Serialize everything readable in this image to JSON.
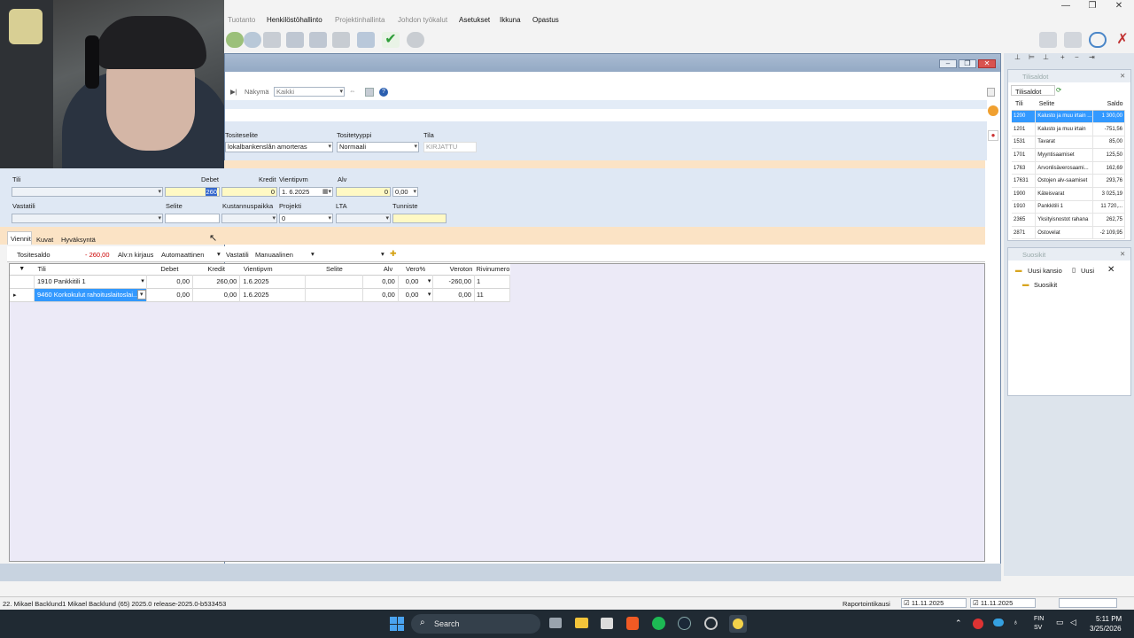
{
  "window": {
    "btn_min": "—",
    "btn_max": "❐",
    "btn_close": "✕"
  },
  "menu": {
    "items": [
      {
        "label": "Tuotanto",
        "enabled": false
      },
      {
        "label": "Henkilöstöhallinto",
        "enabled": true
      },
      {
        "label": "Projektinhallinta",
        "enabled": false
      },
      {
        "label": "Johdon työkalut",
        "enabled": false
      },
      {
        "label": "Asetukset",
        "enabled": true
      },
      {
        "label": "Ikkuna",
        "enabled": true
      },
      {
        "label": "Opastus",
        "enabled": true
      }
    ]
  },
  "nav": {
    "nakyma_label": "Näkymä",
    "nakyma_value": "Kaikki"
  },
  "header_fields": {
    "tositeselite_label": "Tositeselite",
    "tositeselite_value": "lokalbankenslån amorteras",
    "tositetyyppi_label": "Tositetyyppi",
    "tositetyyppi_value": "Normaali",
    "tila_label": "Tila",
    "tila_value": "KIRJATTU"
  },
  "entry": {
    "tili_label": "Tili",
    "debet_label": "Debet",
    "debet_value": "260",
    "kredit_label": "Kredit",
    "kredit_value": "0",
    "vientipvm_label": "Vientipvm",
    "vientipvm_value": "1.  6.2025",
    "alv_label": "Alv",
    "alv_value": "0",
    "alv_pct": "0,00",
    "vastatili_label": "Vastatili",
    "selite_label": "Selite",
    "kustannuspaikka_label": "Kustannuspaikka",
    "projekti_label": "Projekti",
    "projekti_value": "0",
    "lta_label": "LTA",
    "tunniste_label": "Tunniste"
  },
  "tabs": [
    "Viennit",
    "Kuvat",
    "Hyväksyntä"
  ],
  "summary": {
    "tositesaldo_label": "Tositesaldo",
    "tositesaldo_value": "- 260,00",
    "alv_kirjaus_label": "Alv:n kirjaus",
    "alv_kirjaus_value": "Automaattinen",
    "vastatili_label": "Vastatili",
    "vastatili_value": "Manuaalinen"
  },
  "grid": {
    "columns": [
      "Tili",
      "Debet",
      "Kredit",
      "Vientipvm",
      "Selite",
      "Alv",
      "Vero%",
      "Veroton",
      "Rivinumero"
    ],
    "rows": [
      {
        "tili": "1910 Pankkitili 1",
        "debet": "0,00",
        "kredit": "260,00",
        "vientipvm": "1.6.2025",
        "selite": "",
        "alv": "0,00",
        "vero": "0,00",
        "veroton": "-260,00",
        "rivinumero": "1"
      },
      {
        "tili": "9460 Korkokulut rahoituslaitoslai...",
        "debet": "0,00",
        "kredit": "0,00",
        "vientipvm": "1.6.2025",
        "selite": "",
        "alv": "0,00",
        "vero": "0,00",
        "veroton": "0,00",
        "rivinumero": "11"
      }
    ]
  },
  "tilisaldot": {
    "title": "Tilisaldot",
    "tab": "Tilisaldot",
    "columns": [
      "Tili",
      "Selite",
      "Saldo"
    ],
    "rows": [
      {
        "tili": "1200",
        "selite": "Kalusto ja muu irtain ...",
        "saldo": "1 300,00",
        "selected": true
      },
      {
        "tili": "1201",
        "selite": "Kalusto ja muu irtain",
        "saldo": "-751,56"
      },
      {
        "tili": "1531",
        "selite": "Tavarat",
        "saldo": "85,00"
      },
      {
        "tili": "1701",
        "selite": "Myyntisaamiset",
        "saldo": "125,50"
      },
      {
        "tili": "1763",
        "selite": "Arvonlisäverosaami...",
        "saldo": "162,69"
      },
      {
        "tili": "17631",
        "selite": "Ostojen alv-saamiset",
        "saldo": "293,76"
      },
      {
        "tili": "1900",
        "selite": "Käteisvarat",
        "saldo": "3 025,19"
      },
      {
        "tili": "1910",
        "selite": "Pankkitili 1",
        "saldo": "11 720,..."
      },
      {
        "tili": "2365",
        "selite": "Yksityisnostot rahana",
        "saldo": "262,75"
      },
      {
        "tili": "2871",
        "selite": "Ostovelat",
        "saldo": "-2 109,95"
      }
    ]
  },
  "suosikit": {
    "title": "Suosikit",
    "new_folder": "Uusi kansio",
    "new": "Uusi",
    "tree_root": "Suosikit"
  },
  "statusbar": {
    "user_info": "22. Mikael Backlund1  Mikael Backlund (65)  2025.0 release-2025.0-b533453",
    "raportointikausi_label": "Raportointikausi",
    "date_from": "11.11.2025",
    "date_to": "11.11.2025"
  },
  "taskbar": {
    "search_placeholder": "Search",
    "lang_top": "FIN",
    "lang_bottom": "SV",
    "time": "5:11 PM",
    "date": "3/25/2026"
  },
  "colors": {
    "form_bg": "#dfe8f4",
    "band_orange": "#fbe3c5",
    "grid_bg": "#eceaf7",
    "selected_row": "#3399ff",
    "negative": "#cc0000",
    "taskbar": "#202a33"
  }
}
